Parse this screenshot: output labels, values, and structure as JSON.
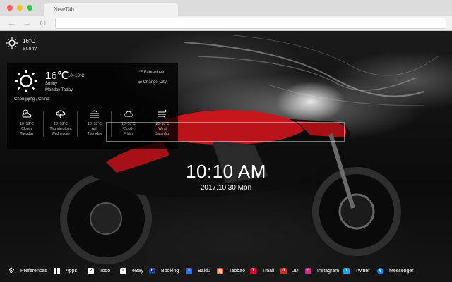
{
  "browser": {
    "tab_title": "NewTab",
    "back_icon": "back-arrow-icon",
    "forward_icon": "forward-arrow-icon",
    "reload_icon": "reload-icon"
  },
  "colors": {
    "dot_close": "#ff5f57",
    "dot_min": "#febc2e",
    "dot_max": "#28c840",
    "bike_red": "#c8161d"
  },
  "weather_mini": {
    "temp": "16°C",
    "condition": "Sunny"
  },
  "weather_panel": {
    "temp": "16℃",
    "range": "10~18°C",
    "condition": "Sunny",
    "date": "Monday Today",
    "unit_label": "°F  Fahrenheit",
    "change_city": "⇄  Change City",
    "location": "Chongqing , China",
    "forecast": [
      {
        "range": "10~18°C",
        "condition": "Cloudy",
        "day": "Tuesday",
        "icon": "cloud-sun-icon"
      },
      {
        "range": "10~18°C",
        "condition": "Thunderstorm",
        "day": "Wednesday",
        "icon": "thunderstorm-icon"
      },
      {
        "range": "10~18°C",
        "condition": "Ash",
        "day": "Thursday",
        "icon": "ash-icon"
      },
      {
        "range": "10~18°C",
        "condition": "Cloudy",
        "day": "Friday",
        "icon": "cloud-icon"
      },
      {
        "range": "10~18°C",
        "condition": "Wind",
        "day": "Saturday",
        "icon": "wind-icon"
      }
    ]
  },
  "clock": {
    "time": "10:10 AM",
    "date": "2017.10.30 Mon"
  },
  "bottom_bar": [
    {
      "label": "Preferences",
      "icon": "gear-icon",
      "color": "#ffffff"
    },
    {
      "label": "Apps",
      "icon": "apps-grid-icon",
      "color": "#ffffff"
    },
    {
      "label": "Todo",
      "icon": "checkbox-icon",
      "color": "#ffffff"
    },
    {
      "label": "eBay",
      "icon": "ebay-icon",
      "color": "#ffffff"
    },
    {
      "label": "Booking",
      "icon": "booking-icon",
      "color": "#1b3fa0"
    },
    {
      "label": "Baidu",
      "icon": "baidu-icon",
      "color": "#2c6de0"
    },
    {
      "label": "Taobao",
      "icon": "taobao-icon",
      "color": "#ff5a00"
    },
    {
      "label": "Tmall",
      "icon": "tmall-icon",
      "color": "#e4002b"
    },
    {
      "label": "JD",
      "icon": "jd-icon",
      "color": "#e1251b"
    },
    {
      "label": "Instagram",
      "icon": "instagram-icon",
      "color": "#c13584"
    },
    {
      "label": "Twitter",
      "icon": "twitter-icon",
      "color": "#1da1f2"
    },
    {
      "label": "Messenger",
      "icon": "messenger-icon",
      "color": "#0084ff"
    }
  ]
}
